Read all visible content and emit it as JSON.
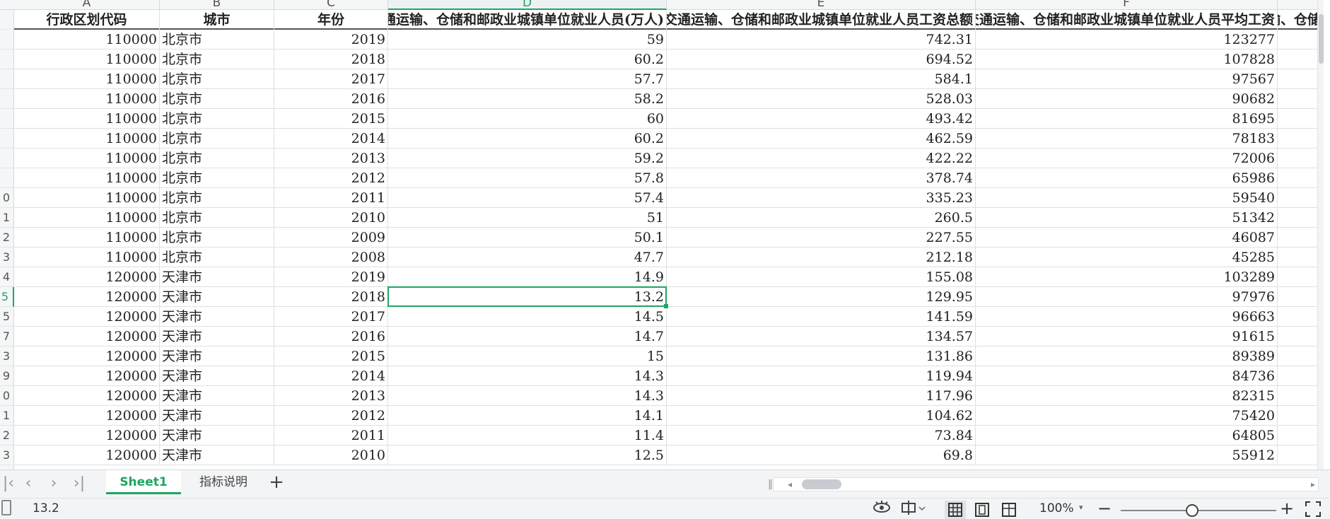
{
  "columns": {
    "letters": [
      "A",
      "B",
      "C",
      "D",
      "E",
      "F",
      ""
    ],
    "active_index": 3
  },
  "header_row": {
    "row_num": "",
    "cells": [
      "行政区划代码",
      "城市",
      "年份",
      "交通运输、仓储和邮政业城镇单位就业人员(万人)",
      "交通运输、仓储和邮政业城镇单位就业人员工资总额",
      "交通运输、仓储和邮政业城镇单位就业人员平均工资",
      "交通运输、仓储"
    ]
  },
  "rows": [
    {
      "row_num": "",
      "code": "110000",
      "city": "北京市",
      "year": "2019",
      "d": "59",
      "e": "742.31",
      "f": "123277"
    },
    {
      "row_num": "",
      "code": "110000",
      "city": "北京市",
      "year": "2018",
      "d": "60.2",
      "e": "694.52",
      "f": "107828"
    },
    {
      "row_num": "",
      "code": "110000",
      "city": "北京市",
      "year": "2017",
      "d": "57.7",
      "e": "584.1",
      "f": "97567"
    },
    {
      "row_num": "",
      "code": "110000",
      "city": "北京市",
      "year": "2016",
      "d": "58.2",
      "e": "528.03",
      "f": "90682"
    },
    {
      "row_num": "",
      "code": "110000",
      "city": "北京市",
      "year": "2015",
      "d": "60",
      "e": "493.42",
      "f": "81695"
    },
    {
      "row_num": "",
      "code": "110000",
      "city": "北京市",
      "year": "2014",
      "d": "60.2",
      "e": "462.59",
      "f": "78183"
    },
    {
      "row_num": "",
      "code": "110000",
      "city": "北京市",
      "year": "2013",
      "d": "59.2",
      "e": "422.22",
      "f": "72006"
    },
    {
      "row_num": "",
      "code": "110000",
      "city": "北京市",
      "year": "2012",
      "d": "57.8",
      "e": "378.74",
      "f": "65986"
    },
    {
      "row_num": "0",
      "code": "110000",
      "city": "北京市",
      "year": "2011",
      "d": "57.4",
      "e": "335.23",
      "f": "59540"
    },
    {
      "row_num": "1",
      "code": "110000",
      "city": "北京市",
      "year": "2010",
      "d": "51",
      "e": "260.5",
      "f": "51342"
    },
    {
      "row_num": "2",
      "code": "110000",
      "city": "北京市",
      "year": "2009",
      "d": "50.1",
      "e": "227.55",
      "f": "46087"
    },
    {
      "row_num": "3",
      "code": "110000",
      "city": "北京市",
      "year": "2008",
      "d": "47.7",
      "e": "212.18",
      "f": "45285"
    },
    {
      "row_num": "4",
      "code": "120000",
      "city": "天津市",
      "year": "2019",
      "d": "14.9",
      "e": "155.08",
      "f": "103289"
    },
    {
      "row_num": "5",
      "code": "120000",
      "city": "天津市",
      "year": "2018",
      "d": "13.2",
      "e": "129.95",
      "f": "97976"
    },
    {
      "row_num": "5",
      "code": "120000",
      "city": "天津市",
      "year": "2017",
      "d": "14.5",
      "e": "141.59",
      "f": "96663"
    },
    {
      "row_num": "7",
      "code": "120000",
      "city": "天津市",
      "year": "2016",
      "d": "14.7",
      "e": "134.57",
      "f": "91615"
    },
    {
      "row_num": "3",
      "code": "120000",
      "city": "天津市",
      "year": "2015",
      "d": "15",
      "e": "131.86",
      "f": "89389"
    },
    {
      "row_num": "9",
      "code": "120000",
      "city": "天津市",
      "year": "2014",
      "d": "14.3",
      "e": "119.94",
      "f": "84736"
    },
    {
      "row_num": "0",
      "code": "120000",
      "city": "天津市",
      "year": "2013",
      "d": "14.3",
      "e": "117.96",
      "f": "82315"
    },
    {
      "row_num": "1",
      "code": "120000",
      "city": "天津市",
      "year": "2012",
      "d": "14.1",
      "e": "104.62",
      "f": "75420"
    },
    {
      "row_num": "2",
      "code": "120000",
      "city": "天津市",
      "year": "2011",
      "d": "11.4",
      "e": "73.84",
      "f": "64805"
    },
    {
      "row_num": "3",
      "code": "120000",
      "city": "天津市",
      "year": "2010",
      "d": "12.5",
      "e": "69.8",
      "f": "55912"
    }
  ],
  "selected_row_index": 13,
  "sheets": {
    "tabs": [
      {
        "label": "Sheet1",
        "active": true
      },
      {
        "label": "指标说明",
        "active": false
      }
    ],
    "add_label": "+"
  },
  "nav": {
    "first": "|‹",
    "prev": "‹",
    "next": "›",
    "last": "›|"
  },
  "status": {
    "selected_value": "13.2",
    "zoom": "100%",
    "zoom_caret": "▾",
    "minus": "−",
    "plus": "+",
    "zoom_level_percent": 100
  },
  "icons": {
    "eye": "eye-icon",
    "sync": "sync-icon",
    "normal_view": "grid-view-icon",
    "page_layout": "page-layout-icon",
    "page_break": "page-break-icon",
    "fullscreen": "fullscreen-icon"
  },
  "colors": {
    "accent": "#1fa463",
    "grid": "#dde0e4",
    "header_bg": "#f5f6f7"
  }
}
